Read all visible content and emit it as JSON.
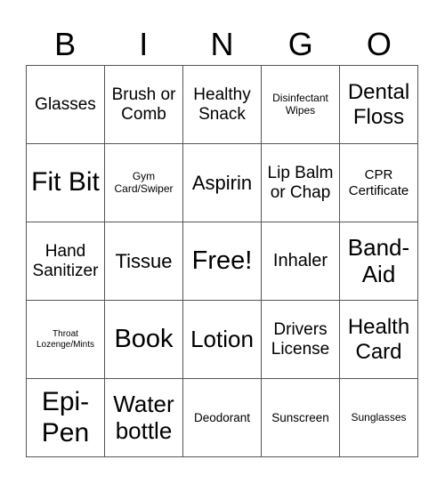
{
  "header": [
    "B",
    "I",
    "N",
    "G",
    "O"
  ],
  "cells": [
    [
      "Glasses",
      "Brush or Comb",
      "Healthy Snack",
      "Disinfectant Wipes",
      "Dental Floss"
    ],
    [
      "Fit Bit",
      "Gym Card/Swiper",
      "Aspirin",
      "Lip Balm or Chap",
      "CPR Certificate"
    ],
    [
      "Hand Sanitizer",
      "Tissue",
      "Free!",
      "Inhaler",
      "Band-Aid"
    ],
    [
      "Throat Lozenge/Mints",
      "Book",
      "Lotion",
      "Drivers License",
      "Health Card"
    ],
    [
      "Epi-Pen",
      "Water bottle",
      "Deodorant",
      "Sunscreen",
      "Sunglasses"
    ]
  ]
}
